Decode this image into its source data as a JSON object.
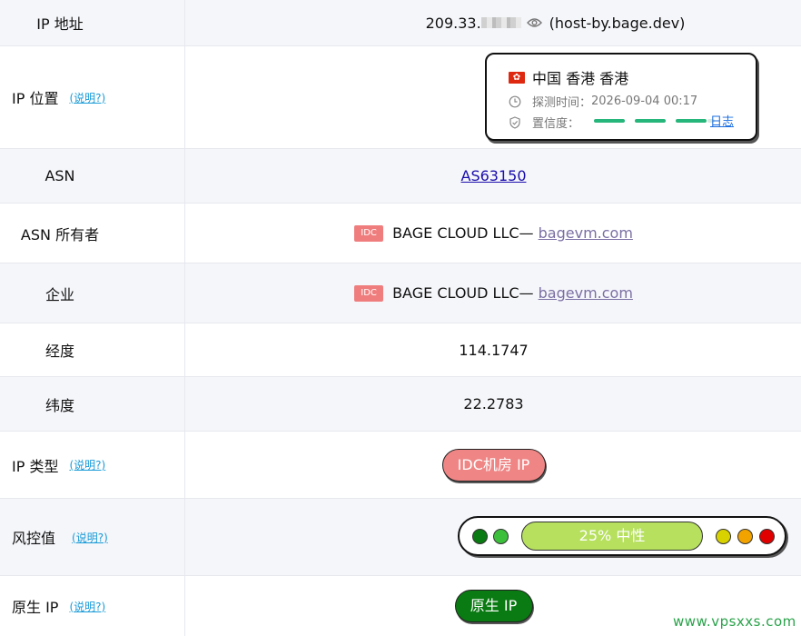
{
  "explain_label": "(说明?)",
  "rows": {
    "ip": {
      "label": "IP 地址",
      "prefix": "209.33.",
      "suffix": "(host-by.bage.dev)"
    },
    "location": {
      "label": "IP 位置",
      "place": "中国 香港 香港",
      "detect_label": "探测时间：",
      "detect_time": "2026-09-04 00:17",
      "confidence_label": "置信度：",
      "log_link": "日志"
    },
    "asn": {
      "label": "ASN",
      "value": "AS63150"
    },
    "asn_owner": {
      "label": "ASN 所有者",
      "badge": "IDC",
      "name": "BAGE CLOUD LLC—",
      "domain": "bagevm.com"
    },
    "company": {
      "label": "企业",
      "badge": "IDC",
      "name": "BAGE CLOUD LLC—",
      "domain": "bagevm.com"
    },
    "longitude": {
      "label": "经度",
      "value": "114.1747"
    },
    "latitude": {
      "label": "纬度",
      "value": "22.2783"
    },
    "ip_type": {
      "label": "IP 类型",
      "value": "IDC机房 IP"
    },
    "risk": {
      "label": "风控值",
      "text": "25%  中性",
      "level": 0.25,
      "dot_colors": [
        "#0a7a12",
        "#3cc03c",
        "#d8d200",
        "#f2a300",
        "#e00000"
      ]
    },
    "native_ip": {
      "label": "原生 IP",
      "value": "原生 IP"
    }
  },
  "watermark": "www.vpsxxs.com",
  "colors": {
    "accent_link": "#1a9bd7",
    "idc_badge": "#ef7d7d",
    "risk_fill": "#b6e05e",
    "native_green": "#0a7a12"
  }
}
